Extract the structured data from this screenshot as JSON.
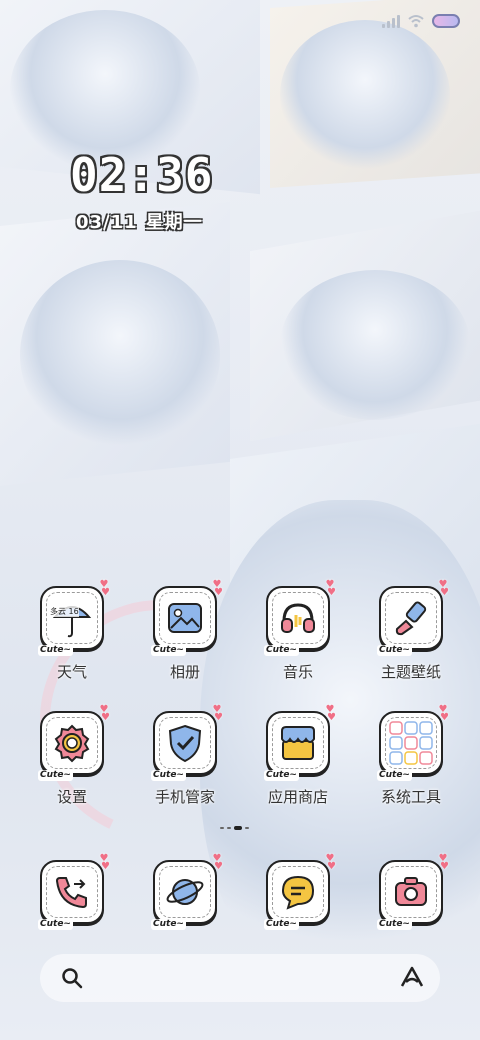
{
  "status_bar": {
    "signal_icon": "cellular-signal-icon",
    "wifi_icon": "wifi-icon",
    "battery_icon": "battery-icon"
  },
  "lock_clock": {
    "time": "02:36",
    "date": "03/11",
    "weekday": "星期一"
  },
  "apps": [
    {
      "id": "weather",
      "label": "天气",
      "badge": "Cute~",
      "icon": "weather-umbrella-icon",
      "widget_text": "多云 16"
    },
    {
      "id": "gallery",
      "label": "相册",
      "badge": "Cute~",
      "icon": "gallery-icon"
    },
    {
      "id": "music",
      "label": "音乐",
      "badge": "Cute~",
      "icon": "headphones-icon"
    },
    {
      "id": "themes",
      "label": "主题壁纸",
      "badge": "Cute~",
      "icon": "paintbrush-icon"
    },
    {
      "id": "settings",
      "label": "设置",
      "badge": "Cute~",
      "icon": "gear-icon"
    },
    {
      "id": "security",
      "label": "手机管家",
      "badge": "Cute~",
      "icon": "shield-check-icon"
    },
    {
      "id": "appstore",
      "label": "应用商店",
      "badge": "Cute~",
      "icon": "store-icon"
    },
    {
      "id": "tools",
      "label": "系统工具",
      "badge": "Cute~",
      "icon": "app-folder-icon"
    },
    {
      "id": "phone",
      "label": "",
      "badge": "Cute~",
      "icon": "phone-icon"
    },
    {
      "id": "browser",
      "label": "",
      "badge": "Cute~",
      "icon": "planet-browser-icon"
    },
    {
      "id": "messages",
      "label": "",
      "badge": "Cute~",
      "icon": "message-bubble-icon"
    },
    {
      "id": "camera",
      "label": "",
      "badge": "Cute~",
      "icon": "camera-icon"
    }
  ],
  "dock": {
    "search_icon": "search-icon",
    "assistant_icon": "assistant-icon"
  },
  "colors": {
    "heart": "#f06f86",
    "tile_border": "#222222",
    "accent_blue": "#6f9fe0"
  }
}
